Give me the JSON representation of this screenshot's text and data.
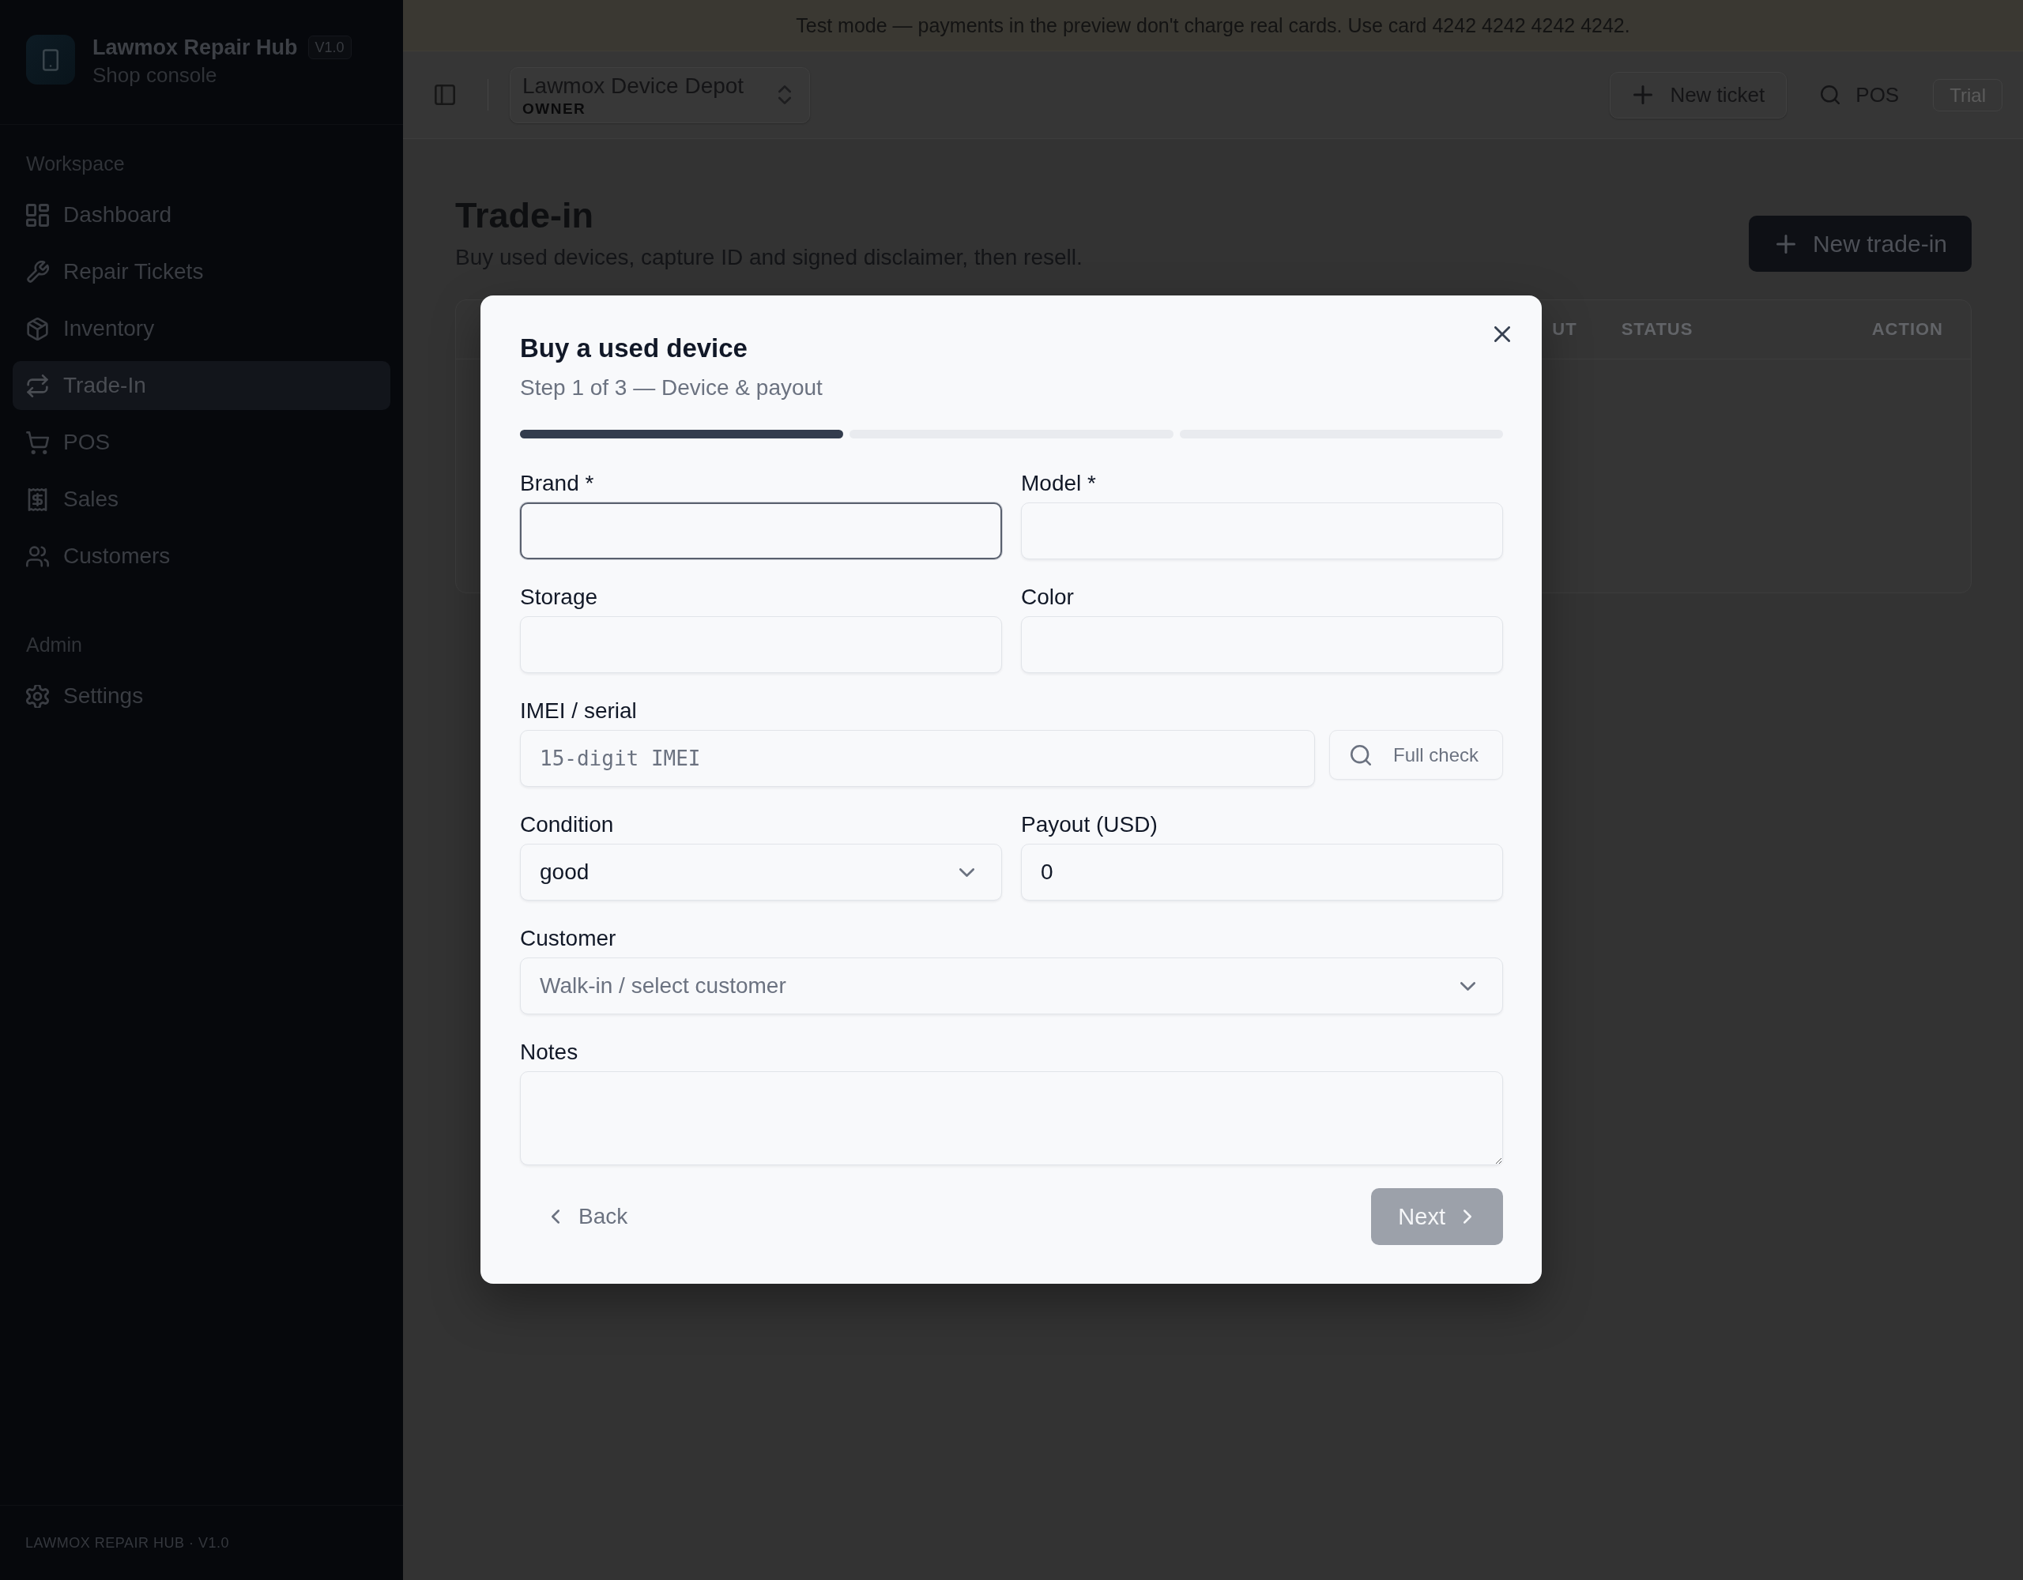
{
  "banner": {
    "text": "Test mode — payments in the preview don't charge real cards. Use card 4242 4242 4242 4242."
  },
  "sidebar": {
    "brand": {
      "name": "Lawmox Repair Hub",
      "version": "V1.0",
      "subtitle": "Shop console"
    },
    "sections": [
      {
        "label": "Workspace",
        "items": [
          {
            "label": "Dashboard",
            "selected": false
          },
          {
            "label": "Repair Tickets",
            "selected": false
          },
          {
            "label": "Inventory",
            "selected": false
          },
          {
            "label": "Trade-In",
            "selected": true
          },
          {
            "label": "POS",
            "selected": false
          },
          {
            "label": "Sales",
            "selected": false
          },
          {
            "label": "Customers",
            "selected": false
          }
        ]
      },
      {
        "label": "Admin",
        "items": [
          {
            "label": "Settings",
            "selected": false
          }
        ]
      }
    ],
    "footer": "LAWMOX REPAIR HUB · V1.0"
  },
  "topbar": {
    "shop": {
      "name": "Lawmox Device Depot",
      "role": "OWNER"
    },
    "actions": [
      {
        "label": "New ticket",
        "kind": "outline"
      },
      {
        "label": "POS",
        "kind": "ghost"
      }
    ],
    "plan_badge": "Trial"
  },
  "page": {
    "title": "Trade-in",
    "subtitle": "Buy used devices, capture ID and signed disclaimer, then resell.",
    "primary_action": "New trade-in"
  },
  "table": {
    "columns": [
      "UT",
      "STATUS",
      "ACTION"
    ]
  },
  "dialog": {
    "title": "Buy a used device",
    "subtitle": "Step 1 of 3 — Device & payout",
    "steps": [
      {
        "active": true
      },
      {
        "active": false
      },
      {
        "active": false
      }
    ],
    "form_rows": [
      {
        "fields": [
          {
            "label": "Brand *",
            "kind": "text",
            "focused": true
          },
          {
            "label": "Model *",
            "kind": "text",
            "focused": false
          }
        ]
      },
      {
        "fields": [
          {
            "label": "Storage",
            "kind": "text",
            "focused": false
          },
          {
            "label": "Color",
            "kind": "text",
            "focused": false
          }
        ]
      },
      {
        "fields": [
          {
            "label": "IMEI / serial",
            "kind": "mono_text",
            "placeholder": "15-digit IMEI",
            "focused": false,
            "button": {
              "label": "Full check",
              "disabled": true
            }
          }
        ]
      },
      {
        "fields": [
          {
            "label": "Condition",
            "kind": "select",
            "value": "good",
            "focused": false
          },
          {
            "label": "Payout (USD)",
            "kind": "number",
            "value": "0",
            "focused": false
          }
        ]
      },
      {
        "fields": [
          {
            "label": "Customer",
            "kind": "select",
            "placeholder": "Walk-in / select customer",
            "focused": false
          }
        ]
      },
      {
        "fields": [
          {
            "label": "Notes",
            "kind": "textarea",
            "focused": false
          }
        ]
      }
    ],
    "back": {
      "label": "Back"
    },
    "next": {
      "label": "Next",
      "disabled": true
    }
  }
}
